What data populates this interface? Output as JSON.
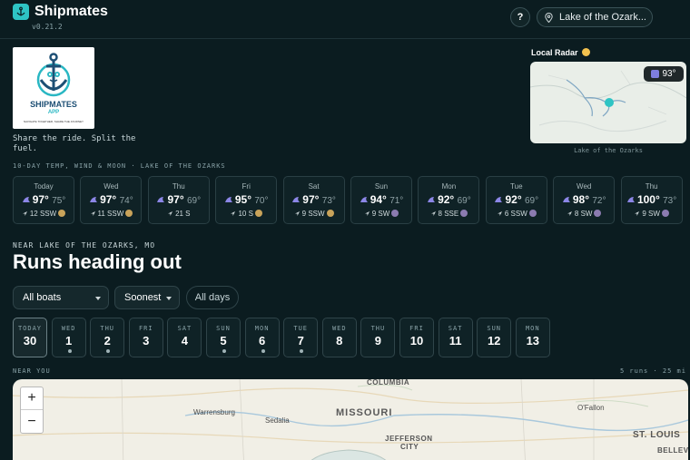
{
  "header": {
    "app_name": "Shipmates",
    "version": "v0.21.2",
    "help_label": "?",
    "location": "Lake of the Ozark..."
  },
  "brand": {
    "logo_name": "SHIPMATES",
    "logo_sub": "APP",
    "logo_tagline": "NAVIGATE TOGETHER, SHARE THE JOURNEY",
    "tagline": "Share the ride. Split the fuel."
  },
  "radar": {
    "title": "Local Radar",
    "temp": "93°",
    "caption": "Lake of the Ozarks"
  },
  "forecast": {
    "title": "10-DAY TEMP, WIND & MOON · LAKE OF THE OZARKS",
    "days": [
      {
        "day": "Today",
        "hi": "97°",
        "lo": "75°",
        "wind": "12 SSW"
      },
      {
        "day": "Wed",
        "hi": "97°",
        "lo": "74°",
        "wind": "11 SSW"
      },
      {
        "day": "Thu",
        "hi": "97°",
        "lo": "69°",
        "wind": "21 S"
      },
      {
        "day": "Fri",
        "hi": "95°",
        "lo": "70°",
        "wind": "10 S"
      },
      {
        "day": "Sat",
        "hi": "97°",
        "lo": "73°",
        "wind": "9 SSW"
      },
      {
        "day": "Sun",
        "hi": "94°",
        "lo": "71°",
        "wind": "9 SW"
      },
      {
        "day": "Mon",
        "hi": "92°",
        "lo": "69°",
        "wind": "8 SSE"
      },
      {
        "day": "Tue",
        "hi": "92°",
        "lo": "69°",
        "wind": "6 SSW"
      },
      {
        "day": "Wed",
        "hi": "98°",
        "lo": "72°",
        "wind": "8 SW"
      },
      {
        "day": "Thu",
        "hi": "100°",
        "lo": "73°",
        "wind": "9 SW"
      }
    ]
  },
  "runs": {
    "near_label": "NEAR LAKE OF THE OZARKS, MO",
    "heading": "Runs heading out",
    "filter_boats": "All boats",
    "filter_sort": "Soonest",
    "filter_days": "All days",
    "dates": [
      {
        "wd": "TODAY",
        "dn": "30"
      },
      {
        "wd": "WED",
        "dn": "1"
      },
      {
        "wd": "THU",
        "dn": "2"
      },
      {
        "wd": "FRI",
        "dn": "3"
      },
      {
        "wd": "SAT",
        "dn": "4"
      },
      {
        "wd": "SUN",
        "dn": "5"
      },
      {
        "wd": "MON",
        "dn": "6"
      },
      {
        "wd": "TUE",
        "dn": "7"
      },
      {
        "wd": "WED",
        "dn": "8"
      },
      {
        "wd": "THU",
        "dn": "9"
      },
      {
        "wd": "FRI",
        "dn": "10"
      },
      {
        "wd": "SAT",
        "dn": "11"
      },
      {
        "wd": "SUN",
        "dn": "12"
      },
      {
        "wd": "MON",
        "dn": "13"
      }
    ],
    "near_you": "NEAR YOU",
    "summary": "5 runs · 25 mi"
  },
  "map": {
    "zoom_in": "+",
    "zoom_out": "−",
    "labels": {
      "columbia": "COLUMBIA",
      "warrensburg": "Warrensburg",
      "sedalia": "Sedalia",
      "missouri": "MISSOURI",
      "jefferson": "JEFFERSON",
      "city": "CITY",
      "ofallon": "O'Fallon",
      "stlouis": "ST. LOUIS",
      "belleville": "BELLEV"
    }
  },
  "colors": {
    "accent": "#2ec4c4",
    "background": "#0b1c20",
    "card": "#0f2226"
  }
}
